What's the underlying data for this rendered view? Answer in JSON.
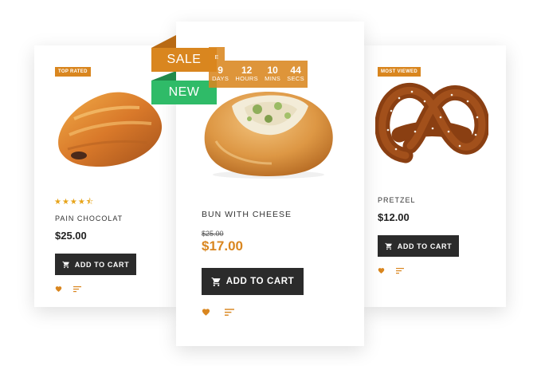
{
  "products": {
    "left": {
      "badge": "TOP RATED",
      "stars": "★★★★⯪",
      "name": "PAIN CHOCOLAT",
      "price": "$25.00",
      "cart_label": "ADD TO CART"
    },
    "center": {
      "name": "BUN WITH CHEESE",
      "old_price": "$25.00",
      "price": "$17.00",
      "cart_label": "ADD TO CART",
      "sale_label": "SALE",
      "new_label": "NEW",
      "countdown": {
        "days": "9",
        "days_label": "DAYS",
        "hours": "12",
        "hours_label": "HOURS",
        "mins": "10",
        "mins_label": "MINS",
        "secs": "44",
        "secs_label": "SECS",
        "partial_label": "E"
      }
    },
    "right": {
      "badge": "MOST VIEWED",
      "name": "PRETZEL",
      "price": "$12.00",
      "cart_label": "ADD TO CART"
    }
  },
  "colors": {
    "accent": "#d9861f",
    "new_green": "#2fbb68",
    "button_dark": "#2b2b2b"
  },
  "icons": [
    "heart-icon",
    "compare-icon",
    "cart-icon"
  ]
}
